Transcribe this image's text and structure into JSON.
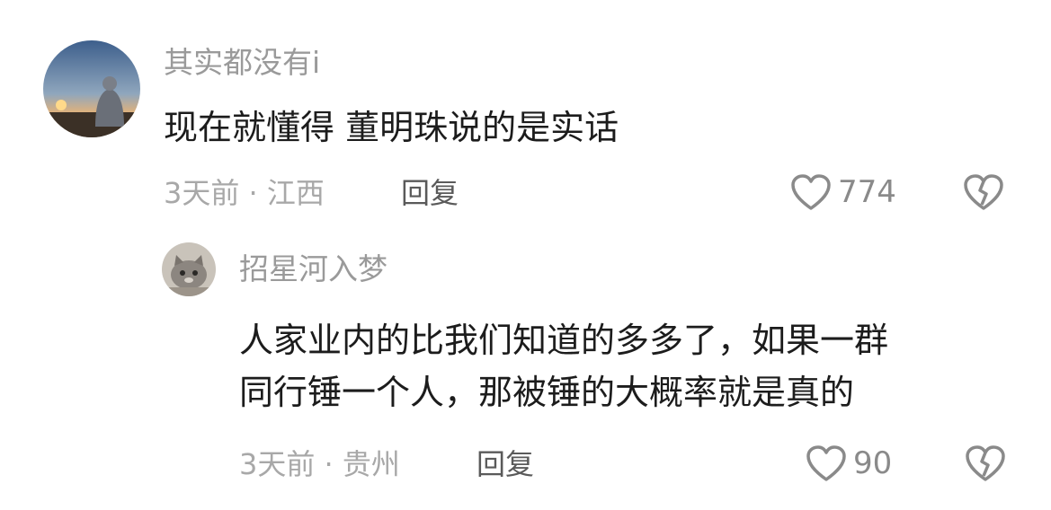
{
  "comments": [
    {
      "username": "其实都没有i",
      "text": "现在就懂得 董明珠说的是实话",
      "meta": "3天前 · 江西",
      "reply_label": "回复",
      "like_count": "774",
      "like_icon": "heart-outline-icon",
      "dislike_icon": "broken-heart-icon"
    },
    {
      "username": "招星河入梦",
      "text_lines": [
        "人家业内的比我们知道的多多了，如果一群",
        "同行锤一个人，那被锤的大概率就是真的"
      ],
      "meta": "3天前 · 贵州",
      "reply_label": "回复",
      "like_count": "90",
      "like_icon": "heart-outline-icon",
      "dislike_icon": "broken-heart-icon"
    }
  ],
  "colors": {
    "username": "#9a9a9a",
    "text": "#1c1c1c",
    "meta": "#a8a8a8",
    "reply": "#5a5a5a",
    "icon": "#8a8a8a"
  }
}
